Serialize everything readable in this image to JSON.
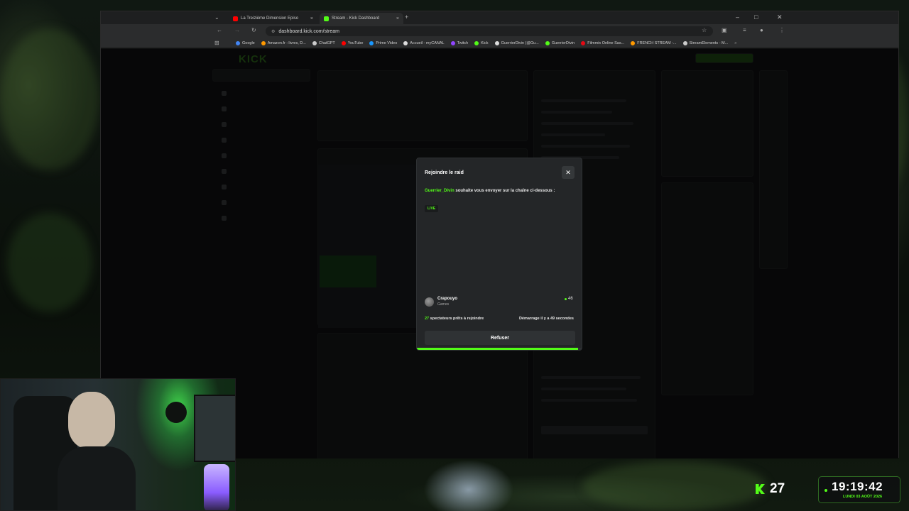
{
  "browser": {
    "tabs": [
      {
        "title": "La Treizième Dimension Episo",
        "icon": "youtube-icon",
        "color": "#ff0000"
      },
      {
        "title": "Stream - Kick Dashboard",
        "icon": "kick-icon",
        "color": "#53fc18"
      }
    ],
    "url": "dashboard.kick.com/stream",
    "bookmarks": [
      {
        "label": "Google",
        "color": "#4285f4"
      },
      {
        "label": "Amazon.fr : livres, D...",
        "color": "#ff9900"
      },
      {
        "label": "ChatGPT",
        "color": "#cccccc"
      },
      {
        "label": "YouTube",
        "color": "#ff0000"
      },
      {
        "label": "Prime Video",
        "color": "#1a98ff"
      },
      {
        "label": "Accueil - myCANAL",
        "color": "#dddddd"
      },
      {
        "label": "Twitch",
        "color": "#9146ff"
      },
      {
        "label": "Kick",
        "color": "#53fc18"
      },
      {
        "label": "GuerrierDivin (@Gu...",
        "color": "#dddddd"
      },
      {
        "label": "GuerrierDivin",
        "color": "#53fc18"
      },
      {
        "label": "Filmmix Online Sas...",
        "color": "#e50914"
      },
      {
        "label": "FRENCH STREAM -...",
        "color": "#ff9900"
      },
      {
        "label": "StreamElements - M...",
        "color": "#cccccc"
      }
    ]
  },
  "modal": {
    "title": "Rejoindre le raid",
    "raider": "Guerrier_Divin",
    "message": "souhaite vous envoyer sur la chaîne ci-dessous :",
    "live_label": "LIVE",
    "channel_name": "Crapouyo",
    "channel_category": "Games",
    "channel_viewers": "46",
    "ready_count": "27",
    "ready_text": "spectateurs prêts à rejoindre",
    "countdown": "Démarrage il y a 49 secondes",
    "refuse_label": "Refuser",
    "progress": 0.98
  },
  "overlay": {
    "viewer_count": "27",
    "time": "19:19:42",
    "date": "LUNDI 03 AOÛT 2026"
  },
  "colors": {
    "accent": "#53fc18",
    "modal_bg": "#242628"
  }
}
